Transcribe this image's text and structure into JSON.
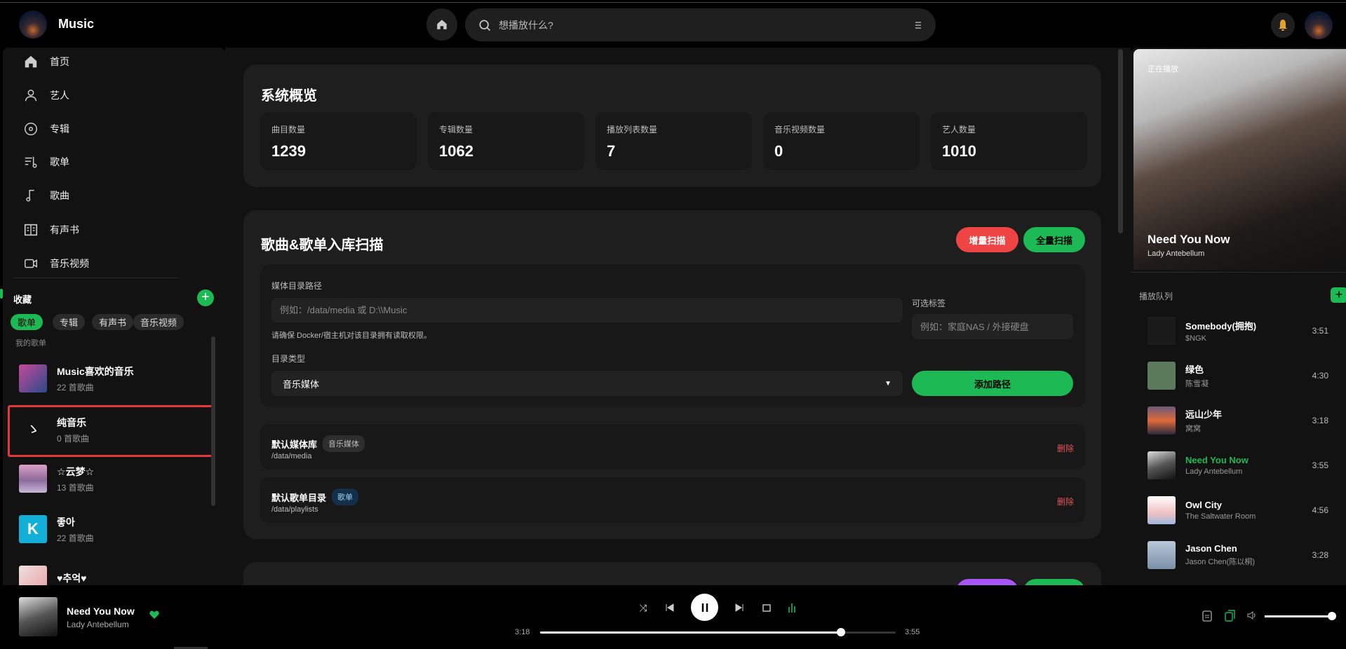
{
  "app": {
    "title": "Music"
  },
  "search": {
    "placeholder": "想播放什么?"
  },
  "sidebar": {
    "nav": [
      {
        "label": "首页",
        "icon": "home-icon"
      },
      {
        "label": "艺人",
        "icon": "user-icon"
      },
      {
        "label": "专辑",
        "icon": "disc-icon"
      },
      {
        "label": "歌单",
        "icon": "playlist-icon"
      },
      {
        "label": "歌曲",
        "icon": "music-note-icon"
      },
      {
        "label": "有声书",
        "icon": "book-icon"
      },
      {
        "label": "音乐视频",
        "icon": "video-icon"
      }
    ],
    "favorites_title": "收藏",
    "chips": [
      "歌单",
      "专辑",
      "有声书",
      "音乐视频"
    ],
    "my_playlists": "我的歌单",
    "playlists": [
      {
        "name": "Music喜欢的音乐",
        "count": "22 首歌曲"
      },
      {
        "name": "纯音乐",
        "count": "0 首歌曲"
      },
      {
        "name": "☆云梦☆",
        "count": "13 首歌曲"
      },
      {
        "name": "좋아",
        "count": "22 首歌曲"
      },
      {
        "name": "♥추억♥",
        "count": ""
      }
    ]
  },
  "overview": {
    "title": "系统概览",
    "stats": [
      {
        "label": "曲目数量",
        "value": "1239"
      },
      {
        "label": "专辑数量",
        "value": "1062"
      },
      {
        "label": "播放列表数量",
        "value": "7"
      },
      {
        "label": "音乐视频数量",
        "value": "0"
      },
      {
        "label": "艺人数量",
        "value": "1010"
      }
    ]
  },
  "scan": {
    "title": "歌曲&歌单入库扫描",
    "incremental": "增量扫描",
    "full": "全量扫描",
    "path_label": "媒体目录路径",
    "path_placeholder": "例如：/data/media 或 D:\\\\Music",
    "hint": "请确保 Docker/宿主机对该目录拥有读取权限。",
    "type_label": "目录类型",
    "type_value": "音乐媒体",
    "tag_label": "可选标签",
    "tag_placeholder": "例如：家庭NAS / 外接硬盘",
    "add": "添加路径",
    "rows": [
      {
        "name": "默认媒体库",
        "badge": "音乐媒体",
        "path": "/data/media",
        "delete": "删除"
      },
      {
        "name": "默认歌单目录",
        "badge": "歌单",
        "path": "/data/playlists",
        "delete": "删除"
      }
    ]
  },
  "now_playing": {
    "label": "正在播放",
    "title": "Need You Now",
    "artist": "Lady Antebellum"
  },
  "queue": {
    "title": "播放队列",
    "items": [
      {
        "title": "Somebody(拥抱)",
        "artist": "$NGK",
        "duration": "3:51"
      },
      {
        "title": "绿色",
        "artist": "陈雪凝",
        "duration": "4:30"
      },
      {
        "title": "远山少年",
        "artist": "窝窝",
        "duration": "3:18"
      },
      {
        "title": "Need You Now",
        "artist": "Lady Antebellum",
        "duration": "3:55",
        "active": true
      },
      {
        "title": "Owl City",
        "artist": "The Saltwater Room",
        "duration": "4:56"
      },
      {
        "title": "Jason Chen",
        "artist": "Jason Chen(陈以桐)",
        "duration": "3:28"
      }
    ]
  },
  "player": {
    "title": "Need You Now",
    "artist": "Lady Antebellum",
    "elapsed": "3:18",
    "total": "3:55",
    "progress": 0.846,
    "volume": 1.0
  },
  "colors": {
    "accent": "#1db954",
    "danger": "#ef4444",
    "purple": "#a855f7"
  }
}
